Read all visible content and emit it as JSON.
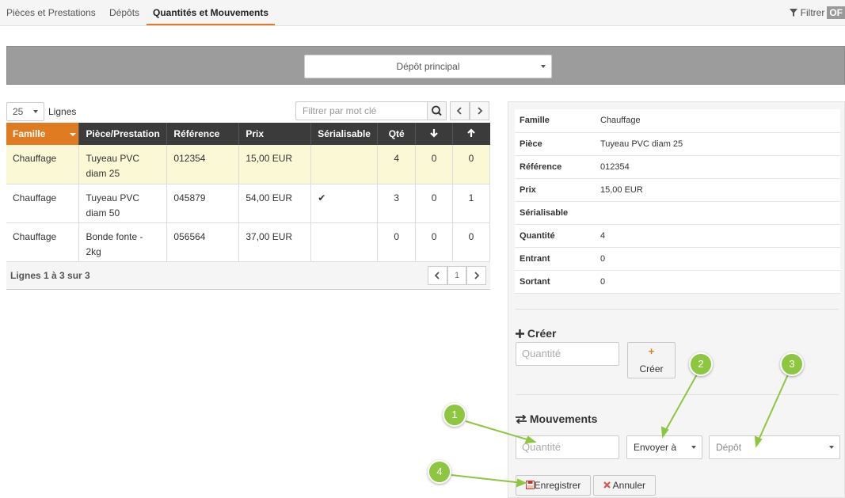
{
  "tabs": [
    {
      "label": "Pièces et Prestations",
      "active": false
    },
    {
      "label": "Dépôts",
      "active": false
    },
    {
      "label": "Quantités et Mouvements",
      "active": true
    }
  ],
  "filter": {
    "label": "Filtrer",
    "toggle": "OF"
  },
  "depot_select": {
    "value": "Dépôt principal"
  },
  "table_controls": {
    "page_size": "25",
    "lines_label": "Lignes",
    "search_placeholder": "Filtrer par mot clé"
  },
  "grid": {
    "columns": [
      "Famille",
      "Pièce/Prestation",
      "Référence",
      "Prix",
      "Sérialisable",
      "Qté",
      "↓",
      "↑"
    ],
    "rows": [
      {
        "famille": "Chauffage",
        "piece": "Tuyeau PVC diam 25",
        "reference": "012354",
        "prix": "15,00 EUR",
        "serialisable": "",
        "qte": "4",
        "in": "0",
        "out": "0",
        "selected": true
      },
      {
        "famille": "Chauffage",
        "piece": "Tuyeau PVC diam 50",
        "reference": "045879",
        "prix": "54,00 EUR",
        "serialisable": "✔",
        "qte": "3",
        "in": "0",
        "out": "1",
        "selected": false
      },
      {
        "famille": "Chauffage",
        "piece": "Bonde fonte - 2kg",
        "reference": "056564",
        "prix": "37,00 EUR",
        "serialisable": "",
        "qte": "0",
        "in": "0",
        "out": "0",
        "selected": false
      }
    ],
    "footer_info": "Lignes 1 à 3 sur 3",
    "current_page": "1"
  },
  "details": [
    {
      "label": "Famille",
      "value": "Chauffage"
    },
    {
      "label": "Pièce",
      "value": "Tuyeau PVC diam 25"
    },
    {
      "label": "Référence",
      "value": "012354"
    },
    {
      "label": "Prix",
      "value": "15,00 EUR"
    },
    {
      "label": "Sérialisable",
      "value": ""
    },
    {
      "label": "Quantité",
      "value": "4"
    },
    {
      "label": "Entrant",
      "value": "0"
    },
    {
      "label": "Sortant",
      "value": "0"
    }
  ],
  "create_section": {
    "title": "Créer",
    "quantity_placeholder": "Quantité",
    "button_label": "Créer"
  },
  "movements_section": {
    "title": "Mouvements",
    "quantity_placeholder": "Quantité",
    "action_select": "Envoyer à",
    "depot_placeholder": "Dépôt",
    "save_label": "Enregistrer",
    "cancel_label": "Annuler"
  },
  "annotations": [
    "1",
    "2",
    "3",
    "4"
  ],
  "colors": {
    "accent": "#e07b22",
    "header_dark": "#3b3b3b",
    "selected_row": "#fbf8d5",
    "annotation": "#8dc63f"
  }
}
